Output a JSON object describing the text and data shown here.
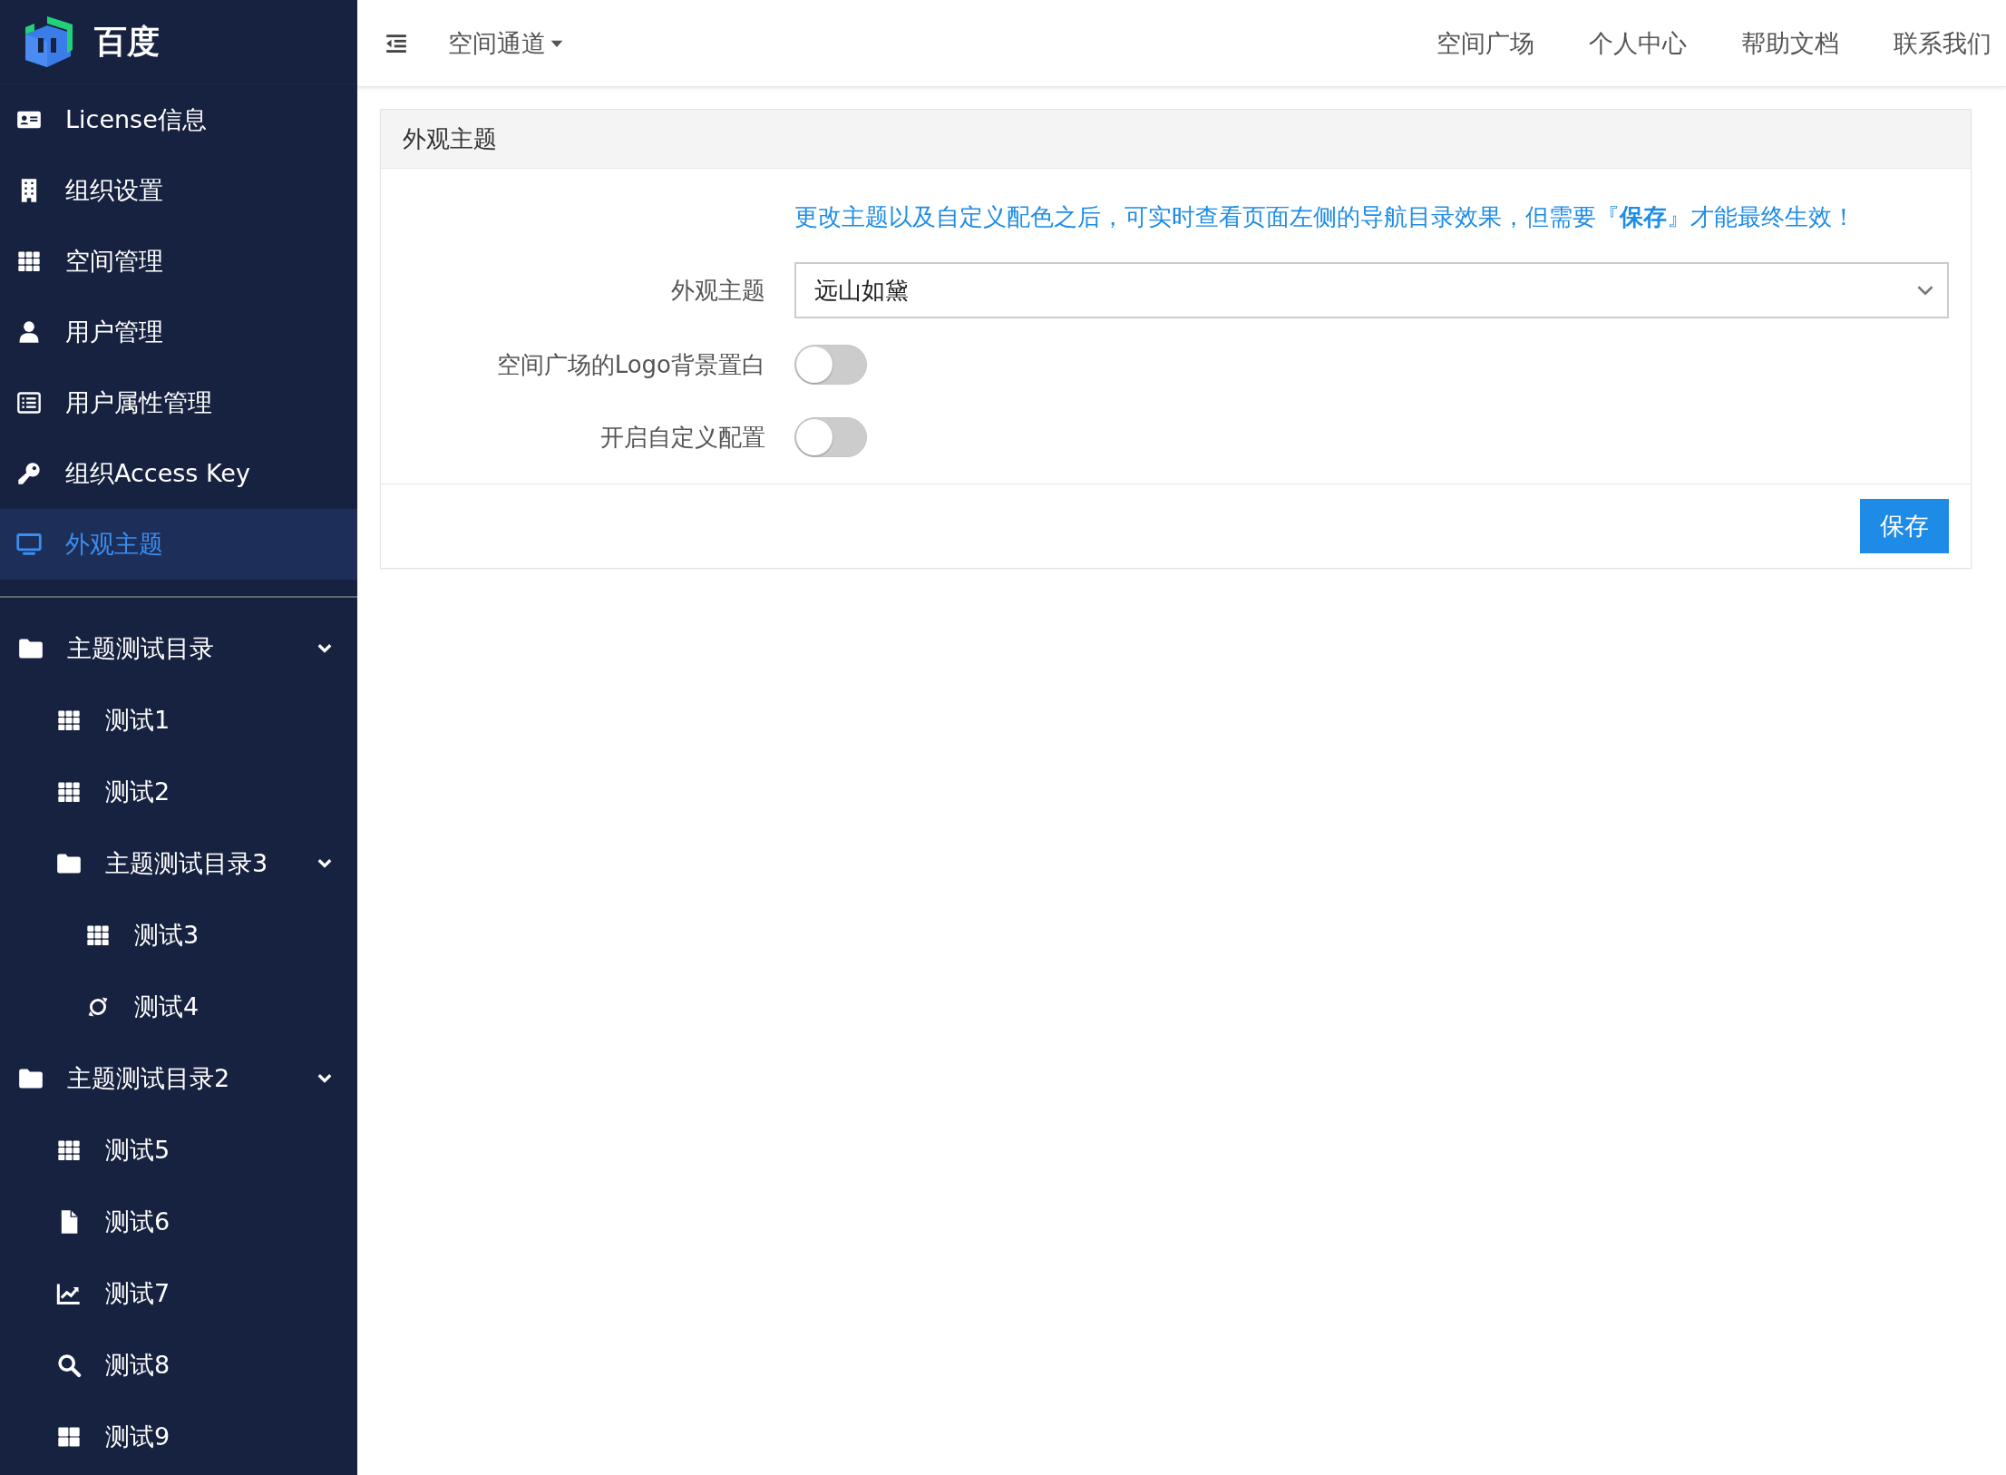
{
  "sidebar": {
    "brand": "百度",
    "menu": [
      {
        "label": "License信息",
        "kind": "idcard",
        "selected": false
      },
      {
        "label": "组织设置",
        "kind": "building",
        "selected": false
      },
      {
        "label": "空间管理",
        "kind": "grid",
        "selected": false
      },
      {
        "label": "用户管理",
        "kind": "user",
        "selected": false
      },
      {
        "label": "用户属性管理",
        "kind": "list",
        "selected": false
      },
      {
        "label": "组织Access Key",
        "kind": "key",
        "selected": false
      },
      {
        "label": "外观主题",
        "kind": "monitor",
        "selected": true
      }
    ],
    "tree": [
      {
        "label": "主题测试目录",
        "kind": "folder",
        "expanded": true,
        "children": [
          {
            "label": "测试1",
            "kind": "grid"
          },
          {
            "label": "测试2",
            "kind": "grid"
          },
          {
            "label": "主题测试目录3",
            "kind": "folder",
            "expanded": true,
            "children": [
              {
                "label": "测试3",
                "kind": "grid"
              },
              {
                "label": "测试4",
                "kind": "sync"
              }
            ]
          }
        ]
      },
      {
        "label": "主题测试目录2",
        "kind": "folder",
        "expanded": true,
        "children": [
          {
            "label": "测试5",
            "kind": "grid"
          },
          {
            "label": "测试6",
            "kind": "file"
          },
          {
            "label": "测试7",
            "kind": "chart"
          },
          {
            "label": "测试8",
            "kind": "search"
          },
          {
            "label": "测试9",
            "kind": "tiles"
          }
        ]
      }
    ]
  },
  "topbar": {
    "space_menu": "空间通道",
    "links": [
      "空间广场",
      "个人中心",
      "帮助文档",
      "联系我们"
    ]
  },
  "panel": {
    "title": "外观主题",
    "notice": "更改主题以及自定义配色之后，可实时查看页面左侧的导航目录效果，但需要『**保存**』才能最终生效！",
    "theme_field": {
      "label": "外观主题",
      "value": "远山如黛"
    },
    "toggles": [
      {
        "label": "空间广场的Logo背景置白",
        "on": false
      },
      {
        "label": "开启自定义配置",
        "on": false
      }
    ],
    "save_button": "保存"
  }
}
